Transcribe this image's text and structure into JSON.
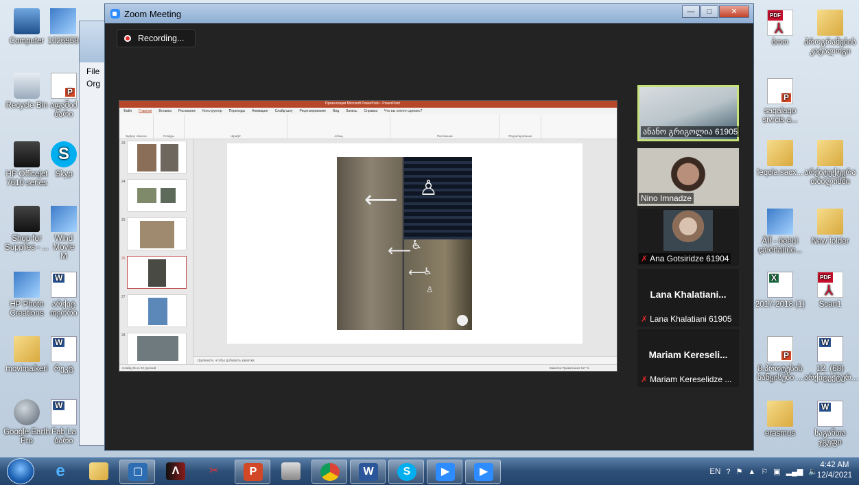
{
  "desktop": {
    "left_icons": [
      {
        "label": "Computer",
        "kind": "pc"
      },
      {
        "label": "1026958",
        "kind": "photo"
      },
      {
        "label": "Recycle Bin",
        "kind": "bin"
      },
      {
        "label": "აფაშიძ ბარი",
        "kind": "ppt"
      },
      {
        "label": "HP Officejet 7610 series",
        "kind": "printer"
      },
      {
        "label": "Skyp",
        "kind": "skype"
      },
      {
        "label": "Shop for Supplies - ...",
        "kind": "printer"
      },
      {
        "label": "Wind Movie M",
        "kind": "photo"
      },
      {
        "label": "HP Photo Creations",
        "kind": "photo"
      },
      {
        "label": "არქიტ თეორი",
        "kind": "doc"
      },
      {
        "label": "movimaikeri",
        "kind": "folder"
      },
      {
        "label": "რეკტ",
        "kind": "doc"
      },
      {
        "label": "Google Earth Pro",
        "kind": "earth"
      },
      {
        "label": "Fab La ბარი",
        "kind": "doc"
      }
    ],
    "right_icons": [
      {
        "label": "ბოო",
        "kind": "pdf"
      },
      {
        "label": "პროგრამების კატალოგი",
        "kind": "folder"
      },
      {
        "label": "saqalaqo sivrcis a...",
        "kind": "ppt"
      },
      {
        "label": "leqcia.sacx...",
        "kind": "folder"
      },
      {
        "label": "არქიტექტურა თბილისში",
        "kind": "folder"
      },
      {
        "label": "ÃÏÎ - ôèëüì çàïèñàííûé...",
        "kind": "photo"
      },
      {
        "label": "New folder",
        "kind": "folder"
      },
      {
        "label": "2017-2018 (1)",
        "kind": "xls"
      },
      {
        "label": "Scan1",
        "kind": "pdf"
      },
      {
        "label": "8.პროტესის საწყისები ...",
        "kind": "ppt"
      },
      {
        "label": "12. (68) არქიტექტურ...",
        "kind": "doc"
      },
      {
        "label": "erasmus",
        "kind": "folder"
      },
      {
        "label": "საგანთა ჯგუფი",
        "kind": "doc"
      }
    ]
  },
  "background_window": {
    "menu_file": "File",
    "menu_org": "Org"
  },
  "zoom": {
    "title": "Zoom Meeting",
    "recording_label": "Recording...",
    "window_buttons": {
      "minimize": "—",
      "maximize": "□",
      "close": "✕"
    }
  },
  "powerpoint": {
    "title": "Презентация Microsoft PowerPoint - PowerPoint",
    "tabs": [
      "Файл",
      "Главная",
      "Вставка",
      "Рисование",
      "Конструктор",
      "Переходы",
      "Анимация",
      "Слайд-шоу",
      "Рецензирование",
      "Вид",
      "Запись",
      "Справка",
      "Что вы хотите сделать?"
    ],
    "ribbon_groups": [
      "Буфер обмена",
      "Слайды",
      "Шрифт",
      "Абзац",
      "Рисование",
      "Редактирование"
    ],
    "slide_numbers": [
      "23",
      "24",
      "25",
      "26",
      "27",
      "28"
    ],
    "selected_slide": "26",
    "notes_placeholder": "Щелкните, чтобы добавить заметки",
    "status_left": "Слайд 26 из 33   русский",
    "status_right": "Заметки   Примечания   117 %"
  },
  "participants": [
    {
      "name": "ანანო გრიგოლია 61905",
      "speaker": true,
      "video": true,
      "muted": false
    },
    {
      "name": "Nino Imnadze",
      "speaker": false,
      "video": true,
      "muted": false
    },
    {
      "name": "Ana Gotsiridze 61904",
      "speaker": false,
      "video": true,
      "muted": true
    },
    {
      "name": "Lana Khalatiani 61905",
      "display": "Lana  Khalatiani...",
      "speaker": false,
      "video": false,
      "muted": true
    },
    {
      "name": "Mariam Kereselidze ...",
      "display": "Mariam  Kereseli...",
      "speaker": false,
      "video": false,
      "muted": true
    }
  ],
  "taskbar": {
    "apps": [
      "ie-icon",
      "explorer-icon",
      "zoom-outline-icon",
      "archicad-icon",
      "snipping-icon",
      "powerpoint-icon",
      "scanner-icon",
      "chrome-icon",
      "word-icon",
      "skype-icon",
      "zoom-icon",
      "zoom-icon-2"
    ],
    "language": "EN",
    "time": "4:42 AM",
    "date": "12/4/2021"
  }
}
